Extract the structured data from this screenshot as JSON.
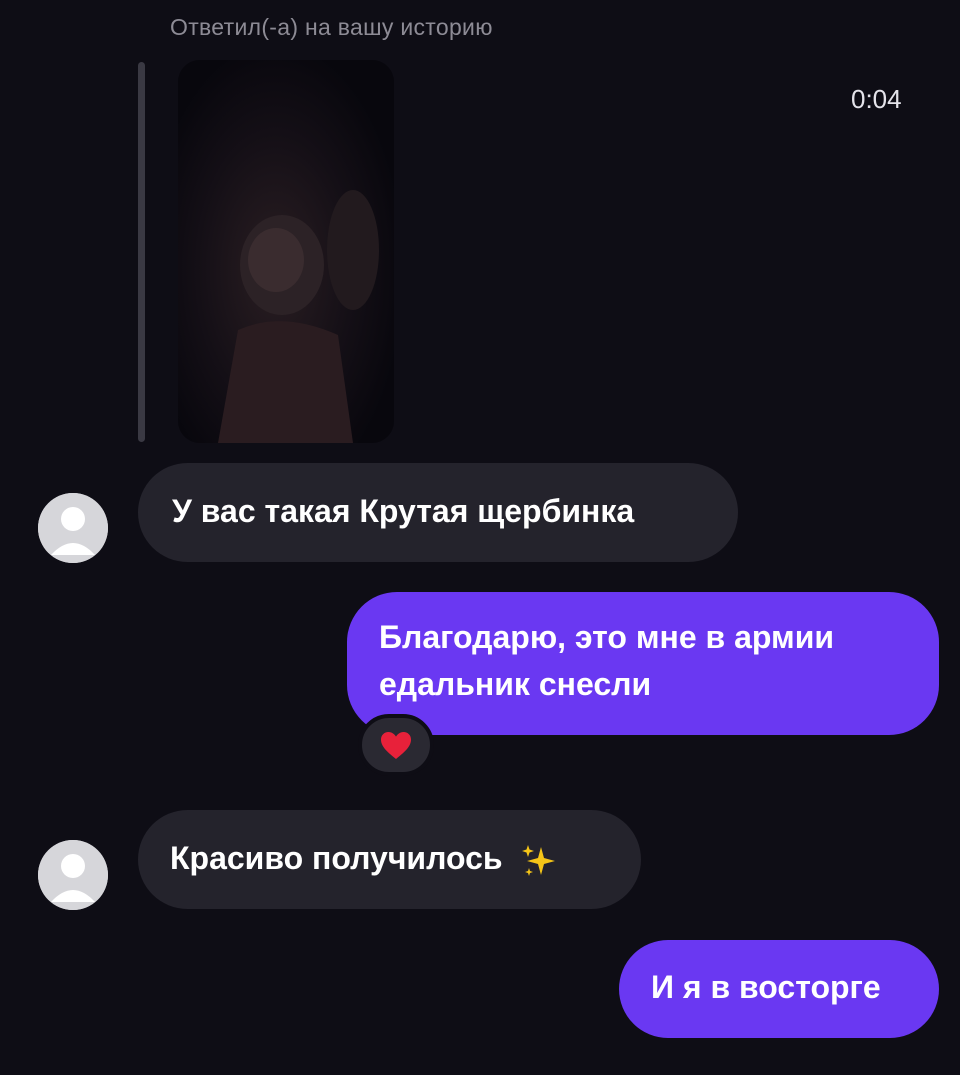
{
  "story": {
    "caption": "Ответил(-а) на вашу историю",
    "duration": "0:04"
  },
  "messages": [
    {
      "direction": "incoming",
      "text": "У вас такая Крутая щербинка"
    },
    {
      "direction": "outgoing",
      "line1": "Благодарю, это мне в армии",
      "line2": "едальник снесли",
      "reaction": "heart-icon"
    },
    {
      "direction": "incoming",
      "text": "Красиво получилось",
      "emoji": "sparkles-icon"
    },
    {
      "direction": "outgoing",
      "text": "И я в восторге"
    }
  ],
  "colors": {
    "background": "#0e0d15",
    "incoming_bubble": "#24232c",
    "outgoing_bubble": "#6a38f2",
    "heart": "#e8213a",
    "sparkle": "#f5c518"
  }
}
